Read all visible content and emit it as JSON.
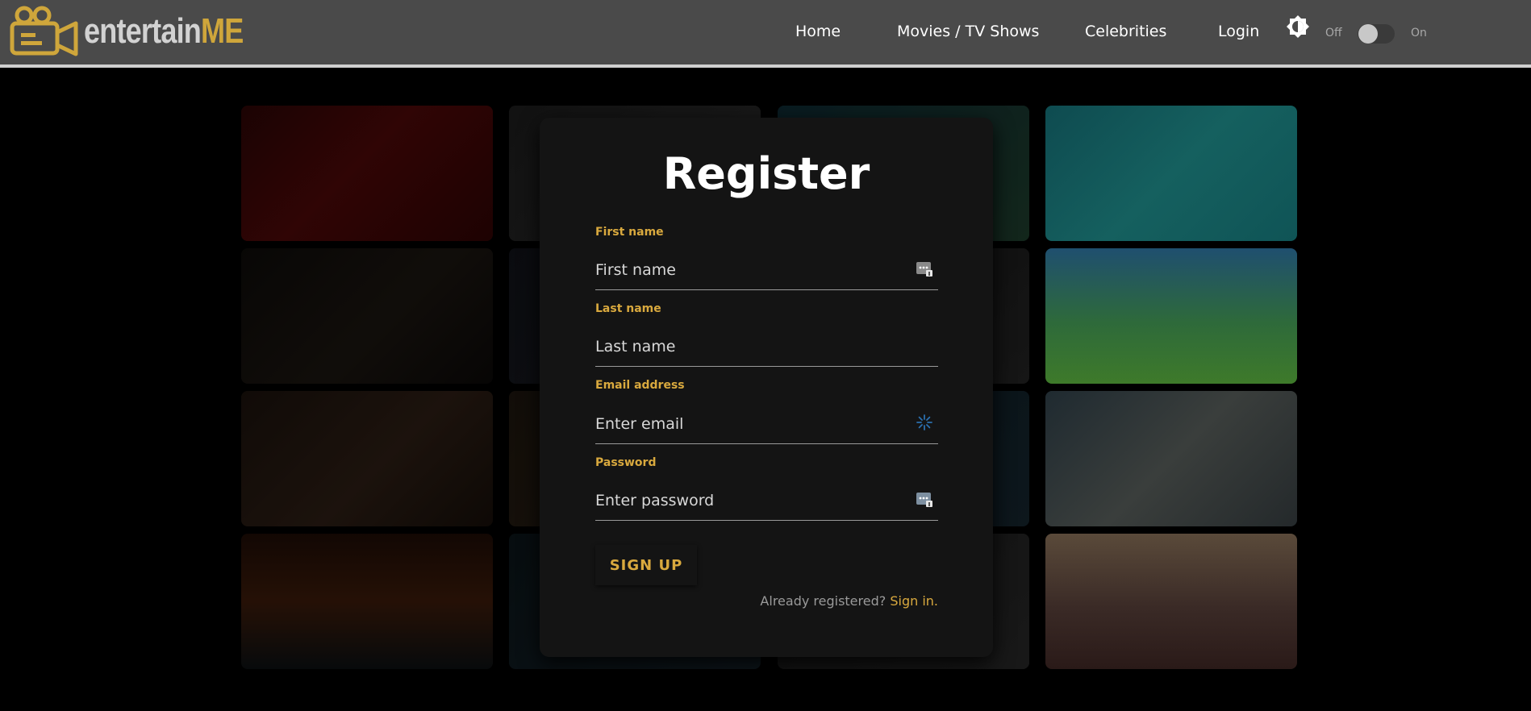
{
  "brand": {
    "part1": "entertain",
    "part2": "ME",
    "accent_color": "#cfa63b"
  },
  "nav": {
    "links": [
      "Home",
      "Movies / TV Shows",
      "Celebrities",
      "Login"
    ],
    "theme_icon": "brightness-icon",
    "toggle_off_label": "Off",
    "toggle_on_label": "On",
    "toggle_state": "off"
  },
  "form": {
    "title": "Register",
    "fields": [
      {
        "label": "First name",
        "placeholder": "First name",
        "value": "",
        "icon": "autofill-icon"
      },
      {
        "label": "Last name",
        "placeholder": "Last name",
        "value": ""
      },
      {
        "label": "Email address",
        "placeholder": "Enter email",
        "value": "",
        "icon": "spinner-icon"
      },
      {
        "label": "Password",
        "placeholder": "Enter password",
        "value": "",
        "icon": "autofill-icon"
      }
    ],
    "submit_label": "SIGN UP",
    "already_text": "Already registered?",
    "signin_label": "Sign in."
  },
  "background_tiles": [
    "poster-tile-1",
    "poster-tile-2",
    "poster-tile-3",
    "poster-tile-4",
    "poster-tile-5",
    "poster-tile-6",
    "poster-tile-7",
    "poster-tile-8",
    "poster-tile-9",
    "poster-tile-10",
    "poster-tile-11",
    "poster-tile-12",
    "poster-tile-13",
    "poster-tile-14",
    "poster-tile-15",
    "poster-tile-16"
  ]
}
